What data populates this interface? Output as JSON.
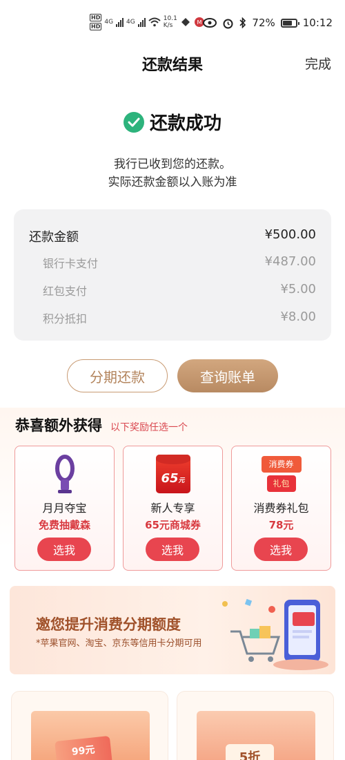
{
  "status_bar": {
    "hd1": "HD",
    "hd2": "HD",
    "net1": "4G",
    "net2": "4G",
    "speed_value": "10.1",
    "speed_unit": "K/s",
    "battery": "72%",
    "battery_level": 0.72,
    "time": "10:12"
  },
  "nav": {
    "title": "还款结果",
    "done_label": "完成"
  },
  "result": {
    "title": "还款成功",
    "line1": "我行已收到您的还款。",
    "line2": "实际还款金额以入账为准"
  },
  "amounts": {
    "total_label": "还款金额",
    "total_value": "¥500.00",
    "items": [
      {
        "label": "银行卡支付",
        "value": "¥487.00"
      },
      {
        "label": "红包支付",
        "value": "¥5.00"
      },
      {
        "label": "积分抵扣",
        "value": "¥8.00"
      }
    ]
  },
  "buttons": {
    "installment": "分期还款",
    "query_bill": "查询账单"
  },
  "rewards": {
    "title": "恭喜额外获得",
    "subtitle": "以下奖励任选一个",
    "cards": [
      {
        "icon": "fan-icon",
        "name": "月月夺宝",
        "desc": "免费抽戴森",
        "pick": "选我"
      },
      {
        "icon": "red-envelope-icon",
        "name": "新人专享",
        "desc": "65元商城券",
        "badge": "65",
        "badge_unit": "元",
        "pick": "选我"
      },
      {
        "icon": "coupon-gift-icon",
        "name": "消费券礼包",
        "desc": "78元",
        "tag1": "消费券",
        "tag2": "礼包",
        "pick": "选我"
      }
    ]
  },
  "banner": {
    "title": "邀您提升消费分期额度",
    "subtitle": "*苹果官网、淘宝、京东等信用卡分期可用"
  },
  "bottom": {
    "left_badge": "99元",
    "right_badge": "5折"
  },
  "colors": {
    "accent": "#c89a72",
    "success": "#2db37c",
    "red": "#e8454f"
  }
}
